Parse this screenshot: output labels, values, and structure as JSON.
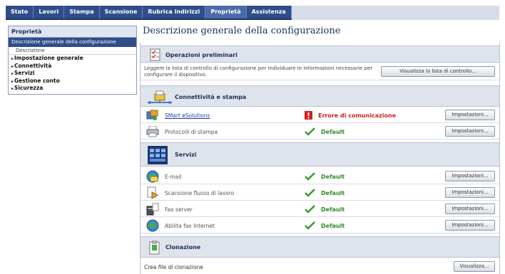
{
  "nav": {
    "tabs": [
      "Stato",
      "Lavori",
      "Stampa",
      "Scansione",
      "Rubrica indirizzi",
      "Proprietà",
      "Assistenza"
    ]
  },
  "sidebar": {
    "header": "Proprietà",
    "selected": "Descrizione generale della configurazione",
    "sub": "Descrizione",
    "items": [
      "Impostazione generale",
      "Connettività",
      "Servizi",
      "Gestione conto",
      "Sicurezza"
    ]
  },
  "main": {
    "title": "Descrizione generale della configurazione",
    "prelim": {
      "title": "Operazioni preliminari",
      "text": "Leggere la lista di controllo di configurazione per individuare le informazioni necessarie per configurare il dispositivo.",
      "button": "Visualizza la lista di controllo..."
    },
    "connect": {
      "title": "Connettività e stampa",
      "rows": [
        {
          "label": "SMart eSolutions",
          "status": "Errore di comunicazione",
          "button": "Impostazioni..."
        },
        {
          "label": "Protocolli di stampa",
          "status": "Default",
          "button": "Impostazioni..."
        }
      ]
    },
    "services": {
      "title": "Servizi",
      "rows": [
        {
          "label": "E-mail",
          "status": "Default",
          "button": "Impostazioni..."
        },
        {
          "label": "Scansione flusso di lavoro",
          "status": "Default",
          "button": "Impostazioni..."
        },
        {
          "label": "Fax server",
          "status": "Default",
          "button": "Impostazioni..."
        },
        {
          "label": "Abilita fax Internet",
          "status": "Default",
          "button": "Impostazioni..."
        }
      ]
    },
    "clone": {
      "title": "Clonazione",
      "label": "Crea file di clonazione",
      "button": "Visualizza..."
    }
  },
  "colors": {
    "nav_bg": "#2f4d8a",
    "section_bg": "#dfe4ec",
    "ok": "#2e8a2a",
    "error": "#c81f1f",
    "link": "#1a3ea8"
  }
}
